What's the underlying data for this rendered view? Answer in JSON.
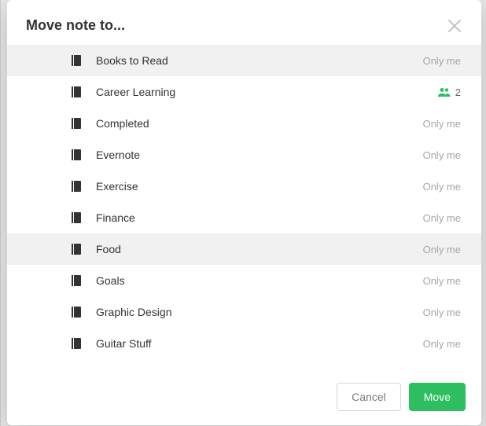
{
  "dialog": {
    "title": "Move note to...",
    "footer": {
      "cancel": "Cancel",
      "move": "Move"
    },
    "meta_only_me": "Only me"
  },
  "notebooks": [
    {
      "label": "Books to Read",
      "shared": false,
      "count": null,
      "selected": true
    },
    {
      "label": "Career Learning",
      "shared": true,
      "count": "2",
      "selected": false
    },
    {
      "label": "Completed",
      "shared": false,
      "count": null,
      "selected": false
    },
    {
      "label": "Evernote",
      "shared": false,
      "count": null,
      "selected": false
    },
    {
      "label": "Exercise",
      "shared": false,
      "count": null,
      "selected": false
    },
    {
      "label": "Finance",
      "shared": false,
      "count": null,
      "selected": false
    },
    {
      "label": "Food",
      "shared": false,
      "count": null,
      "selected": true
    },
    {
      "label": "Goals",
      "shared": false,
      "count": null,
      "selected": false
    },
    {
      "label": "Graphic Design",
      "shared": false,
      "count": null,
      "selected": false
    },
    {
      "label": "Guitar Stuff",
      "shared": false,
      "count": null,
      "selected": false
    }
  ]
}
